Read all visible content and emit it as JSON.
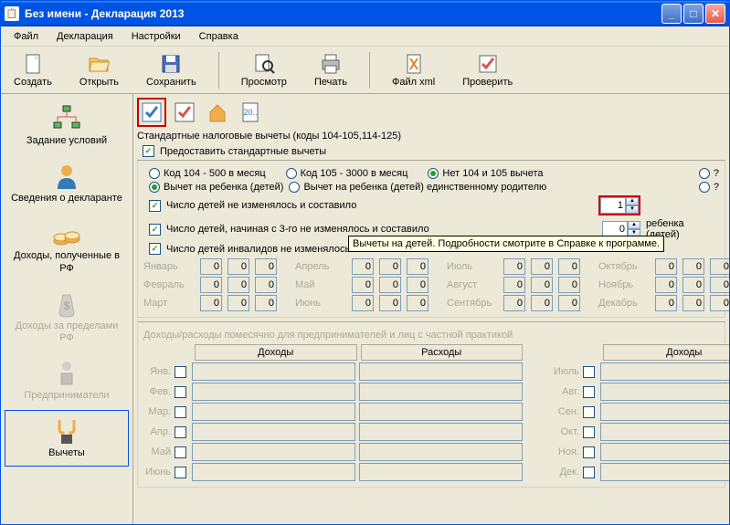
{
  "window": {
    "title": "Без имени - Декларация 2013"
  },
  "menu": {
    "file": "Файл",
    "declaration": "Декларация",
    "settings": "Настройки",
    "help": "Справка"
  },
  "toolbar": {
    "create": "Создать",
    "open": "Открыть",
    "save": "Сохранить",
    "preview": "Просмотр",
    "print": "Печать",
    "xml": "Файл xml",
    "check": "Проверить"
  },
  "sidebar": {
    "items": [
      {
        "label": "Задание условий"
      },
      {
        "label": "Сведения о декларанте"
      },
      {
        "label": "Доходы, полученные в РФ"
      },
      {
        "label": "Доходы за пределами РФ"
      },
      {
        "label": "Предприниматели"
      },
      {
        "label": "Вычеты"
      }
    ]
  },
  "deductions": {
    "title": "Стандартные налоговые вычеты (коды 104-105,114-125)",
    "provide_standard": "Предоставить стандартные вычеты",
    "code104": "Код 104 - 500 в месяц",
    "code105": "Код 105 - 3000 в месяц",
    "no_104_105": "Нет 104 и 105 вычета",
    "question": "?",
    "child_deduction": "Вычет на ребенка (детей)",
    "child_deduction_single": "Вычет на ребенка (детей) единственному родителю",
    "children_not_changed": "Число детей не изменялось и составило",
    "children_from3": "Число детей, начиная с 3-го не изменялось и составило",
    "children_after": "ребенка (детей)",
    "children_disabled": "Число детей инвалидов не изменялось и составило",
    "children_value": "1",
    "children_value2": "0",
    "tooltip": "Вычеты на детей. Подробности смотрите в Справке к программе."
  },
  "months": {
    "jan": "Январь",
    "feb": "Февраль",
    "mar": "Март",
    "apr": "Апрель",
    "may": "Май",
    "jun": "Июнь",
    "jul": "Июль",
    "aug": "Август",
    "sep": "Сентябрь",
    "oct": "Октябрь",
    "nov": "Ноябрь",
    "dec": "Декабрь",
    "val": "0"
  },
  "expenses": {
    "title": "Доходы/расходы помесячно для предпринимателей и лиц с частной практикой",
    "income": "Доходы",
    "expense": "Расходы",
    "months_short": {
      "jan": "Янв.",
      "feb": "Фев.",
      "mar": "Мар.",
      "apr": "Апр.",
      "may": "Май",
      "jun": "Июнь",
      "jul": "Июль",
      "aug": "Авг.",
      "sep": "Сен.",
      "oct": "Окт.",
      "nov": "Ноя.",
      "dec": "Дек."
    }
  }
}
